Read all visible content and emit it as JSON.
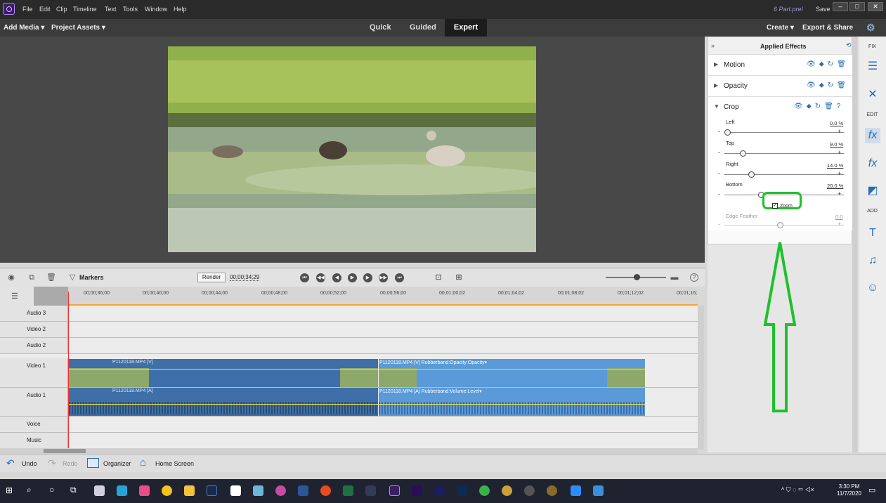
{
  "app": {
    "menu": [
      "File",
      "Edit",
      "Clip",
      "Timeline",
      "Text",
      "Tools",
      "Window",
      "Help"
    ],
    "project_name": "6 Part.prel",
    "save_label": "Save"
  },
  "toolbar": {
    "add_media": "Add Media ▾",
    "project_assets": "Project Assets ▾",
    "modes": [
      "Quick",
      "Guided",
      "Expert"
    ],
    "active_mode": "Expert",
    "create": "Create ▾",
    "export_share": "Export & Share"
  },
  "timeline": {
    "markers_label": "Markers",
    "render_label": "Render",
    "timecode": "00;00;34;29",
    "ruler_ticks": [
      "00;00;36;00",
      "00;00;40;00",
      "00;00;44;00",
      "00;00;48;00",
      "00;00;52;00",
      "00;00;56;00",
      "00;01;00;02",
      "00;01;04;02",
      "00;01;08;02",
      "00;01;12;02",
      "00;01;16;"
    ],
    "tracks": [
      "Audio 3",
      "Video 2",
      "Audio 2",
      "Video 1",
      "Audio 1",
      "Voice",
      "Music"
    ],
    "clips": {
      "v1_a": "P1120118.MP4 [V]",
      "v1_b": "P1120118.MP4 [V] Rubberband:Opacity:Opacity▾",
      "a1_a": "P1120118.MP4 [A]",
      "a1_b": "P1120118.MP4 [A] Rubberband:Volume:Level▾"
    }
  },
  "effects": {
    "title": "Applied Effects",
    "items": [
      "Motion",
      "Opacity",
      "Crop"
    ],
    "crop": {
      "left_label": "Left",
      "left_value": "0.0 %",
      "left_level": 0.0,
      "top_label": "Top",
      "top_value": "9.0 %",
      "top_level": 0.09,
      "right_label": "Right",
      "right_value": "14.0 %",
      "right_level": 0.14,
      "bottom_label": "Bottom",
      "bottom_value": "20.0 %",
      "bottom_level": 0.2,
      "zoom_label": "Zoom",
      "zoom_checked": true,
      "edge_feather_label": "Edge Feather",
      "edge_feather_value": "0.0"
    }
  },
  "sidebar": {
    "fix": "FIX",
    "edit": "EDIT",
    "add": "ADD"
  },
  "bottom": {
    "undo": "Undo",
    "redo": "Redo",
    "organizer": "Organizer",
    "home_screen": "Home Screen"
  },
  "taskbar": {
    "time": "3:30 PM",
    "date": "11/7/2020"
  },
  "colors": {
    "highlight_green": "#1ec12a",
    "accent_blue": "#2a6cb0",
    "clip_blue": "#3e78b8"
  }
}
